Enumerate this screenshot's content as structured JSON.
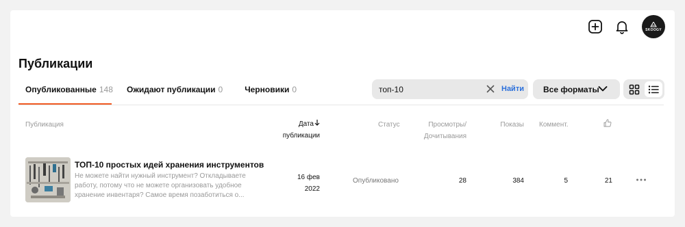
{
  "header": {
    "icons": [
      "plus-square-icon",
      "bell-icon"
    ],
    "avatar_text": "SKOOGY"
  },
  "page": {
    "title": "Публикации"
  },
  "tabs": [
    {
      "label": "Опубликованные",
      "count": "148",
      "active": true
    },
    {
      "label": "Ожидают публикации",
      "count": "0",
      "active": false
    },
    {
      "label": "Черновики",
      "count": "0",
      "active": false
    }
  ],
  "search": {
    "value": "топ-10",
    "button_label": "Найти"
  },
  "format_filter": {
    "selected": "Все форматы"
  },
  "view_modes": {
    "grid": "grid-icon",
    "list": "list-icon",
    "active": "list"
  },
  "columns": {
    "publication": "Публикация",
    "date_line1": "Дата",
    "date_line2": "публикации",
    "status": "Статус",
    "views_line1": "Просмотры/",
    "views_line2": "Дочитывания",
    "shows": "Показы",
    "comments": "Коммент.",
    "likes_icon": "thumbs-up-icon"
  },
  "rows": [
    {
      "title": "ТОП-10 простых идей хранения инструментов",
      "description": "Не можете найти нужный инструмент? Откладываете работу, потому что не можете организовать удобное хранение инвентаря? Самое время позаботиться о...",
      "date_line1": "16 фев",
      "date_line2": "2022",
      "status": "Опубликовано",
      "views": "28",
      "shows": "384",
      "comments": "5",
      "likes": "21"
    }
  ],
  "colors": {
    "accent": "#f05a22",
    "link": "#2a6fdb",
    "muted_text": "#999999",
    "control_bg": "#e8e8e8"
  }
}
